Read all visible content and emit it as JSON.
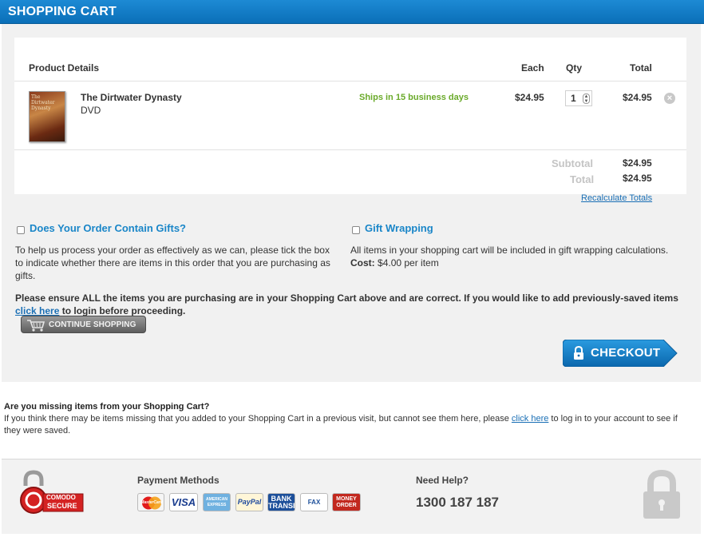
{
  "page": {
    "title": "SHOPPING CART"
  },
  "cart": {
    "headers": {
      "product": "Product Details",
      "each": "Each",
      "qty": "Qty",
      "total": "Total"
    },
    "items": [
      {
        "cover_text": "The Dirtwater Dynasty",
        "name": "The Dirtwater Dynasty",
        "format": "DVD",
        "shipping": "Ships in 15 business days",
        "each": "$24.95",
        "qty": "1",
        "total": "$24.95"
      }
    ],
    "summary": {
      "subtotal_label": "Subtotal",
      "subtotal_value": "$24.95",
      "total_label": "Total",
      "total_value": "$24.95",
      "recalc_link": "Recalculate Totals"
    }
  },
  "gifts": {
    "title": "Does Your Order Contain Gifts?",
    "text": "To help us process your order as effectively as we can, please tick the box to indicate whether there are items in this order that you are purchasing as gifts."
  },
  "wrapping": {
    "title": "Gift Wrapping",
    "text": "All items in your shopping cart will be included in gift wrapping calculations.",
    "cost_label": "Cost:",
    "cost_value": "$4.00 per item"
  },
  "notice": {
    "text_before": "Please ensure ALL the items you are purchasing are in your Shopping Cart above and are correct. If you would like to add previously-saved items ",
    "link": "click here",
    "text_after": " to login before proceeding."
  },
  "buttons": {
    "continue": "CONTINUE SHOPPING",
    "checkout": "CHECKOUT"
  },
  "missing": {
    "title": "Are you missing items from your Shopping Cart?",
    "text_before": "If you think there may be items missing that you added to your Shopping Cart in a previous visit, but cannot see them here, please ",
    "link": "click here",
    "text_after": " to log in to your account to see if they were saved."
  },
  "footer": {
    "seal": {
      "line1": "COMODO",
      "line2": "SECURE"
    },
    "payment_title": "Payment Methods",
    "payment_methods": [
      "MasterCard",
      "VISA",
      "AMERICAN EXPRESS",
      "PayPal",
      "BANK TRANSFER",
      "FAX",
      "MONEY ORDER"
    ],
    "help_title": "Need Help?",
    "help_phone": "1300 187 187"
  },
  "colors": {
    "brand_blue": "#0a6fb8",
    "link_blue": "#1a6fb5",
    "ships_green": "#6aaa2a",
    "panel_gray": "#f1f1f1"
  }
}
